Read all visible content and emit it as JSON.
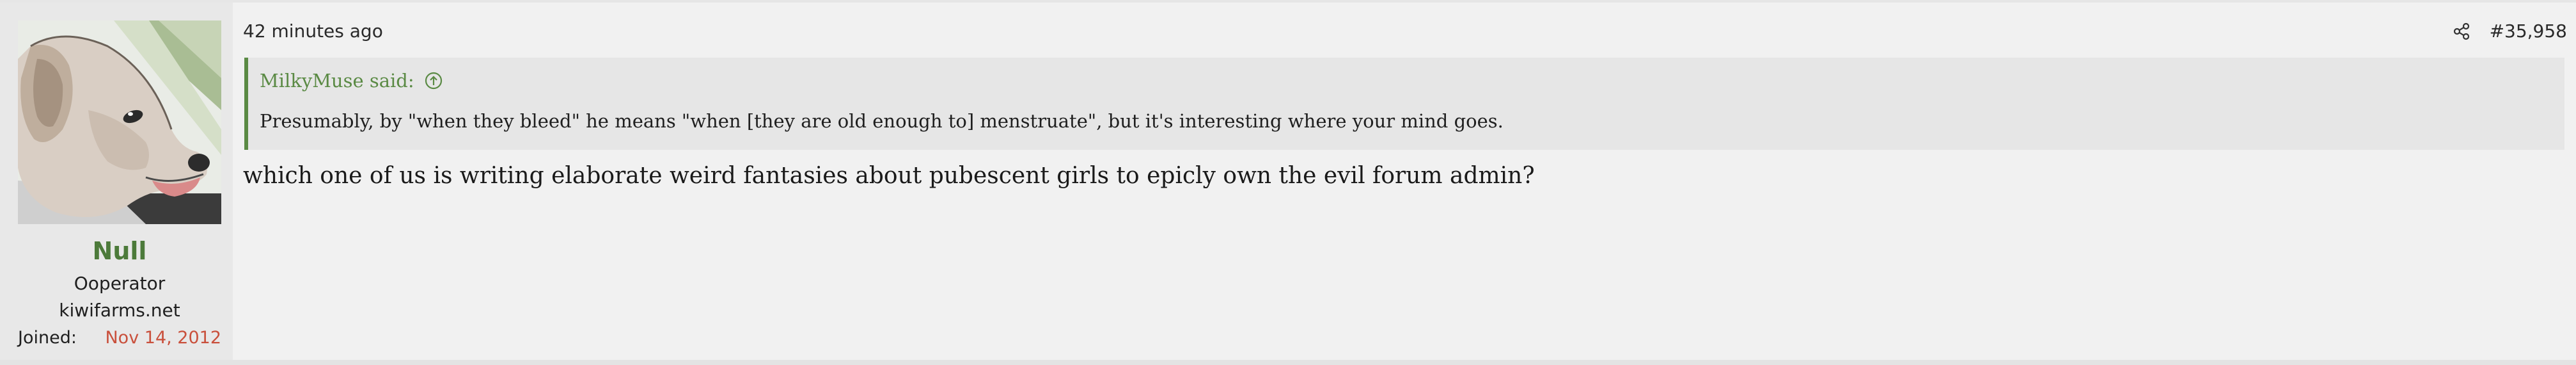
{
  "post": {
    "timestamp": "42 minutes ago",
    "post_number": "#35,958",
    "body": "which one of us is writing elaborate weird fantasies about pubescent girls to epicly own the evil forum admin?"
  },
  "author": {
    "username": "Null",
    "title": "Ooperator",
    "domain": "kiwifarms.net",
    "joined_label": "Joined:",
    "joined_date": "Nov 14, 2012",
    "avatar_icon": "dog-avatar"
  },
  "quote": {
    "attribution": "MilkyMuse said:",
    "text": "Presumably, by \"when they bleed\" he means \"when [they are old enough to] menstruate\", but it's interesting where your mind goes.",
    "jump_icon": "arrow-up-circle-icon"
  },
  "icons": {
    "share": "share-icon"
  },
  "colors": {
    "username": "#4c7a3a",
    "quote_accent": "#5a8a44",
    "joined_date": "#c9503c",
    "post_bg": "#f1f1f1",
    "sidebar_bg": "#e8e8e8"
  }
}
